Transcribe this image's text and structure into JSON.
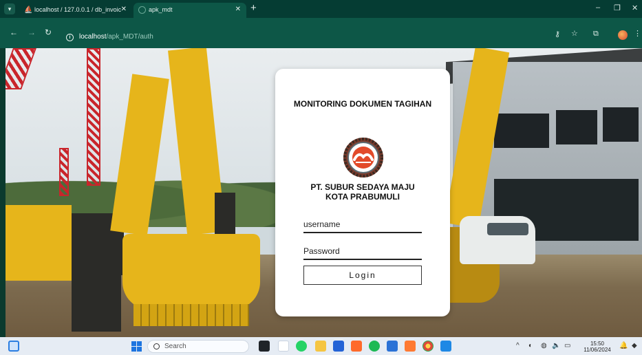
{
  "browser": {
    "tabs": [
      {
        "title": "localhost / 127.0.0.1 / db_invoic",
        "icon": "phpmyadmin-icon",
        "active": false
      },
      {
        "title": "apk_mdt",
        "icon": "globe-icon",
        "active": true
      }
    ],
    "new_tab": "+",
    "address": {
      "host": "localhost",
      "path": "/apk_MDT/auth"
    },
    "window_controls": {
      "minimize": "–",
      "maximize": "❐",
      "close": "✕"
    }
  },
  "login": {
    "title": "MONITORING DOKUMEN TAGIHAN",
    "company_line1": "PT. SUBUR SEDAYA MAJU",
    "company_line2": "KOTA PRABUMULI",
    "username_placeholder": "username",
    "password_placeholder": "Password",
    "login_label": "Login"
  },
  "taskbar": {
    "search_placeholder": "Search",
    "time": "15:50",
    "date": "11/06/2024",
    "tray_chevron": "^"
  },
  "colors": {
    "browser_tabbar": "#053c33",
    "browser_toolbar": "#0d5747",
    "card_background": "#ffffff",
    "taskbar": "#e6ecf4"
  }
}
